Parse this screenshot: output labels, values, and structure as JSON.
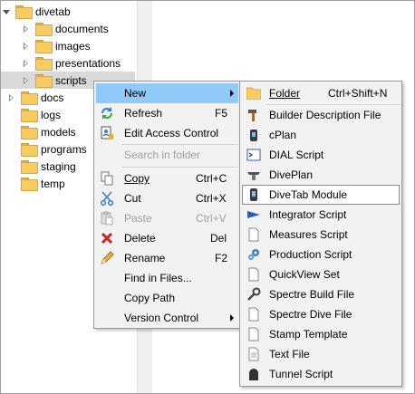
{
  "tree": {
    "items": [
      {
        "label": "divetab",
        "arrow": "down"
      },
      {
        "label": "documents",
        "arrow": "right"
      },
      {
        "label": "images",
        "arrow": "right"
      },
      {
        "label": "presentations",
        "arrow": "right"
      },
      {
        "label": "scripts",
        "arrow": "right"
      },
      {
        "label": "docs",
        "arrow": "right"
      },
      {
        "label": "logs",
        "arrow": "none"
      },
      {
        "label": "models",
        "arrow": "none"
      },
      {
        "label": "programs",
        "arrow": "none"
      },
      {
        "label": "staging",
        "arrow": "none"
      },
      {
        "label": "temp",
        "arrow": "none"
      }
    ]
  },
  "context_menu": {
    "items": [
      {
        "label": "New",
        "shortcut": "",
        "icon": "none",
        "disabled": false,
        "submenu": true
      },
      {
        "label": "Refresh",
        "shortcut": "F5",
        "icon": "refresh-icon",
        "disabled": false
      },
      {
        "label": "Edit Access Control",
        "shortcut": "",
        "icon": "access-control-icon",
        "disabled": false
      },
      {
        "label": "Search in folder",
        "shortcut": "",
        "icon": "none",
        "disabled": true
      },
      {
        "label": "Copy",
        "shortcut": "Ctrl+C",
        "icon": "copy-icon",
        "disabled": false
      },
      {
        "label": "Cut",
        "shortcut": "Ctrl+X",
        "icon": "cut-icon",
        "disabled": false
      },
      {
        "label": "Paste",
        "shortcut": "Ctrl+V",
        "icon": "paste-icon",
        "disabled": true
      },
      {
        "label": "Delete",
        "shortcut": "Del",
        "icon": "delete-icon",
        "disabled": false
      },
      {
        "label": "Rename",
        "shortcut": "F2",
        "icon": "rename-icon",
        "disabled": false
      },
      {
        "label": "Find in Files...",
        "shortcut": "",
        "icon": "none",
        "disabled": false
      },
      {
        "label": "Copy Path",
        "shortcut": "",
        "icon": "none",
        "disabled": false
      },
      {
        "label": "Version Control",
        "shortcut": "",
        "icon": "none",
        "disabled": false,
        "submenu": true
      }
    ]
  },
  "new_submenu": {
    "items": [
      {
        "label": "Folder",
        "shortcut": "Ctrl+Shift+N",
        "icon": "folder-icon"
      },
      {
        "label": "Builder Description File",
        "shortcut": "",
        "icon": "hammer-icon"
      },
      {
        "label": "cPlan",
        "shortcut": "",
        "icon": "cplan-icon"
      },
      {
        "label": "DIAL Script",
        "shortcut": "",
        "icon": "dial-script-icon"
      },
      {
        "label": "DivePlan",
        "shortcut": "",
        "icon": "diveplan-icon"
      },
      {
        "label": "DiveTab Module",
        "shortcut": "",
        "icon": "divetab-module-icon"
      },
      {
        "label": "Integrator Script",
        "shortcut": "",
        "icon": "integrator-icon"
      },
      {
        "label": "Measures Script",
        "shortcut": "",
        "icon": "measures-icon"
      },
      {
        "label": "Production Script",
        "shortcut": "",
        "icon": "production-icon"
      },
      {
        "label": "QuickView Set",
        "shortcut": "",
        "icon": "quickview-icon"
      },
      {
        "label": "Spectre Build File",
        "shortcut": "",
        "icon": "wrench-icon"
      },
      {
        "label": "Spectre Dive File",
        "shortcut": "",
        "icon": "spectre-dive-icon"
      },
      {
        "label": "Stamp Template",
        "shortcut": "",
        "icon": "stamp-icon"
      },
      {
        "label": "Text File",
        "shortcut": "",
        "icon": "text-file-icon"
      },
      {
        "label": "Tunnel Script",
        "shortcut": "",
        "icon": "tunnel-icon"
      }
    ]
  },
  "colors": {
    "hover": "#91c9f7",
    "menu_bg": "#f2f2f2",
    "folder": "#f7cc63",
    "delete_red": "#cc2222"
  }
}
